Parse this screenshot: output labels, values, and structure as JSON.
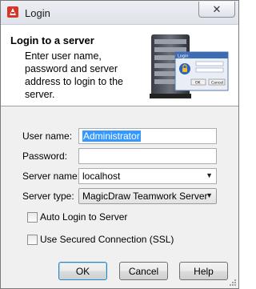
{
  "window": {
    "title": "Login",
    "close_icon": "close-icon"
  },
  "header": {
    "title": "Login to a server",
    "description": "Enter user name, password and server address to login to the server.",
    "art": {
      "icon": "server-login-illustration",
      "dialog_title": "Login",
      "ok": "OK",
      "cancel": "Cancel"
    }
  },
  "form": {
    "user_name": {
      "label": "User name:",
      "value": "Administrator"
    },
    "password": {
      "label": "Password:",
      "value": ""
    },
    "server_name": {
      "label": "Server name:",
      "value": "localhost"
    },
    "server_type": {
      "label": "Server type:",
      "value": "MagicDraw Teamwork Server"
    }
  },
  "options": {
    "auto_login": {
      "label": "Auto Login to Server",
      "checked": false
    },
    "secured": {
      "label": "Use Secured Connection (SSL)",
      "checked": false
    }
  },
  "buttons": {
    "ok": "OK",
    "cancel": "Cancel",
    "help": "Help"
  },
  "colors": {
    "selection": "#3399ff",
    "default_button_border": "#3c7fb1"
  }
}
